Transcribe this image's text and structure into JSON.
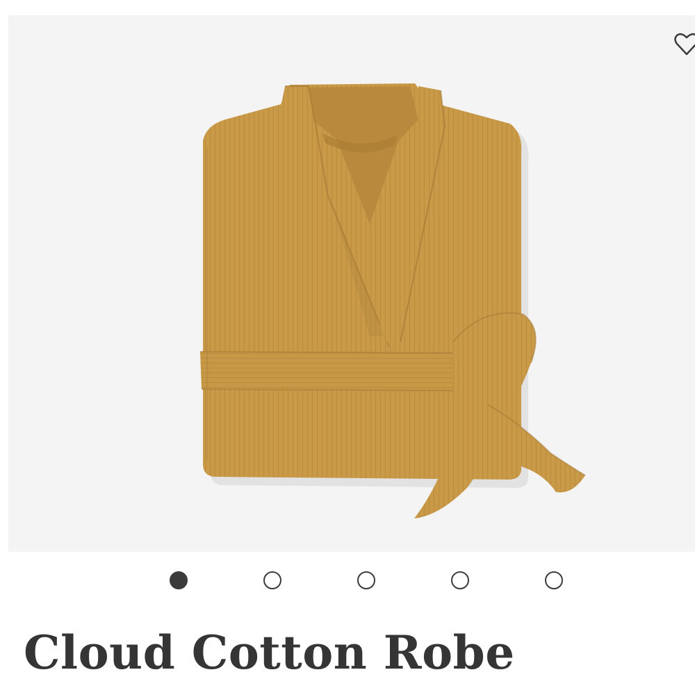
{
  "product": {
    "title": "Cloud Cotton Robe",
    "image_subject": "folded mustard cotton gauze robe with tied belt",
    "wishlist_icon": "heart-outline-icon"
  },
  "carousel": {
    "count": 5,
    "active_index": 0
  },
  "colors": {
    "image_bg": "#f4f4f4",
    "robe": "#c99a48",
    "text": "#353535",
    "dot": "#3b3b3b"
  }
}
